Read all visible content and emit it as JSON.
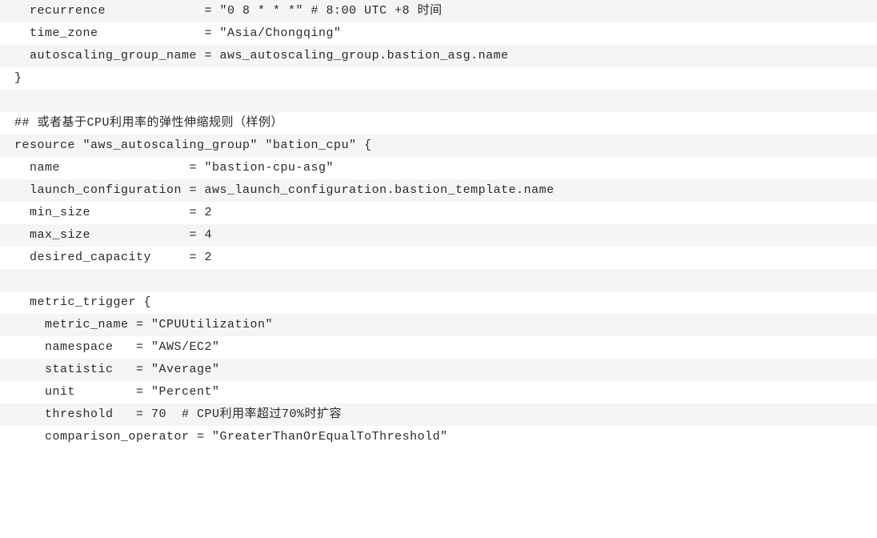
{
  "lines": [
    "  recurrence             = \"0 8 * * *\" # 8:00 UTC +8 时间",
    "  time_zone              = \"Asia/Chongqing\"",
    "  autoscaling_group_name = aws_autoscaling_group.bastion_asg.name",
    "}",
    "",
    "## 或者基于CPU利用率的弹性伸缩规则（样例）",
    "resource \"aws_autoscaling_group\" \"bation_cpu\" {",
    "  name                 = \"bastion-cpu-asg\"",
    "  launch_configuration = aws_launch_configuration.bastion_template.name",
    "  min_size             = 2",
    "  max_size             = 4",
    "  desired_capacity     = 2",
    "",
    "  metric_trigger {",
    "    metric_name = \"CPUUtilization\"",
    "    namespace   = \"AWS/EC2\"",
    "    statistic   = \"Average\"",
    "    unit        = \"Percent\"",
    "    threshold   = 70  # CPU利用率超过70%时扩容",
    "    comparison_operator = \"GreaterThanOrEqualToThreshold\""
  ]
}
